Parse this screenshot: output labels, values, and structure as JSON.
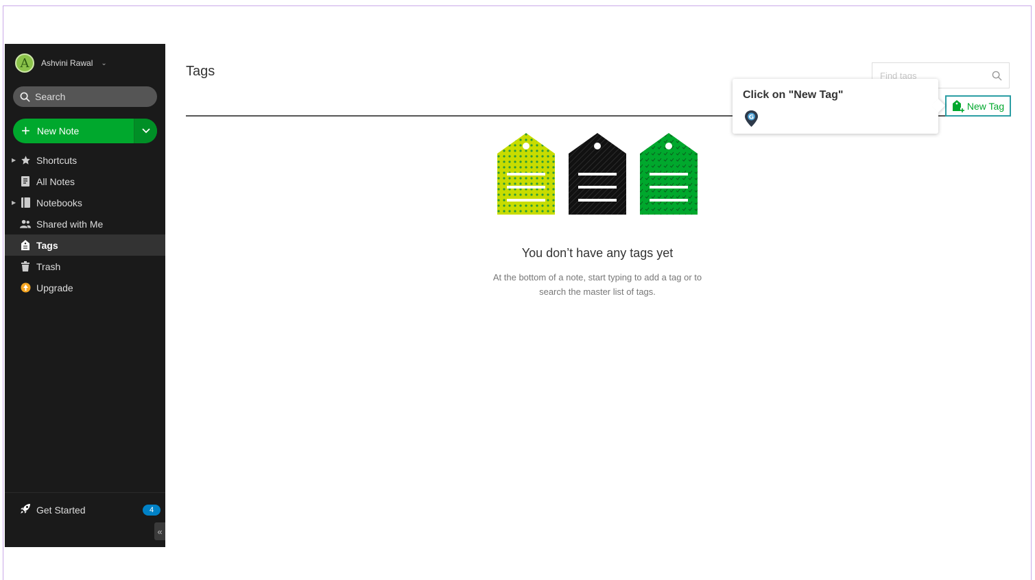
{
  "sidebar": {
    "user": {
      "avatar_letter": "A",
      "name": "Ashvini Rawal"
    },
    "search": {
      "label": "Search"
    },
    "new_note": {
      "label": "New Note"
    },
    "items": [
      {
        "label": "Shortcuts",
        "icon": "star-icon",
        "expandable": true
      },
      {
        "label": "All Notes",
        "icon": "notes-icon",
        "expandable": false
      },
      {
        "label": "Notebooks",
        "icon": "notebook-icon",
        "expandable": true
      },
      {
        "label": "Shared with Me",
        "icon": "people-icon",
        "expandable": false
      },
      {
        "label": "Tags",
        "icon": "tag-icon",
        "expandable": false,
        "active": true
      },
      {
        "label": "Trash",
        "icon": "trash-icon",
        "expandable": false
      },
      {
        "label": "Upgrade",
        "icon": "upgrade-icon",
        "expandable": false
      }
    ],
    "get_started": {
      "label": "Get Started",
      "count": "4"
    },
    "collapse_glyph": "«"
  },
  "main": {
    "title": "Tags",
    "find_tags_placeholder": "Find tags",
    "new_tag_label": "New Tag",
    "empty": {
      "heading": "You don’t have any tags yet",
      "description": "At the bottom of a note, start typing to add a tag or to search the master list of tags."
    }
  },
  "tooltip": {
    "text": "Click on \"New Tag\""
  },
  "colors": {
    "sidebar_bg": "#1a1a1a",
    "accent_green": "#00a82d",
    "tag_lime": "#c8dc00",
    "tag_black": "#111111",
    "tag_green": "#00a82d",
    "badge_blue": "#0081c6",
    "new_tag_border": "#2a9da3"
  }
}
